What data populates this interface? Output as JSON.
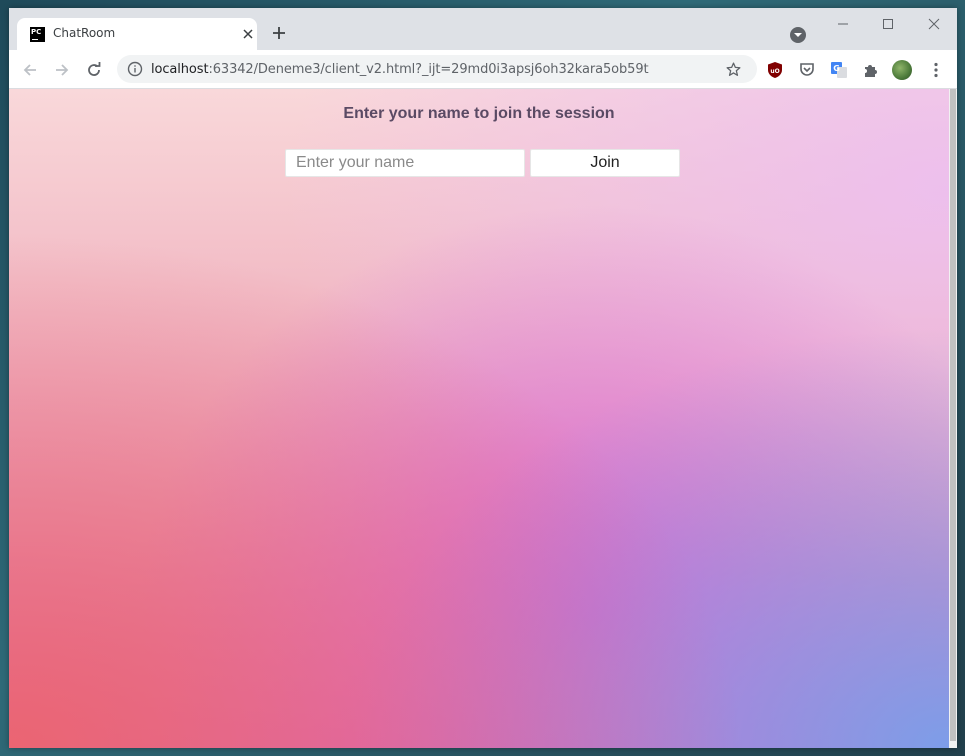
{
  "browser": {
    "tab": {
      "title": "ChatRoom",
      "favicon_text": "PC"
    },
    "url": {
      "host": "localhost",
      "rest": ":63342/Deneme3/client_v2.html?_ijt=29md0i3apsj6oh32kara5ob59t"
    },
    "icons": {
      "back": "arrow-left-icon",
      "forward": "arrow-right-icon",
      "reload": "reload-icon",
      "info": "info-icon",
      "bookmark": "star-icon",
      "extensions": [
        "ublock-icon",
        "pocket-icon",
        "google-translate-icon",
        "puzzle-icon",
        "avatar-icon",
        "more-vert-icon"
      ]
    }
  },
  "page": {
    "heading": "Enter your name to join the session",
    "name_input": {
      "placeholder": "Enter your name",
      "value": ""
    },
    "join_button": "Join"
  },
  "colors": {
    "heading": "#5a4a64",
    "gradient_top": "#f9d8da",
    "gradient_pink": "#d96fb8",
    "gradient_coral": "#ec646e",
    "gradient_blue": "#78a0eb"
  }
}
